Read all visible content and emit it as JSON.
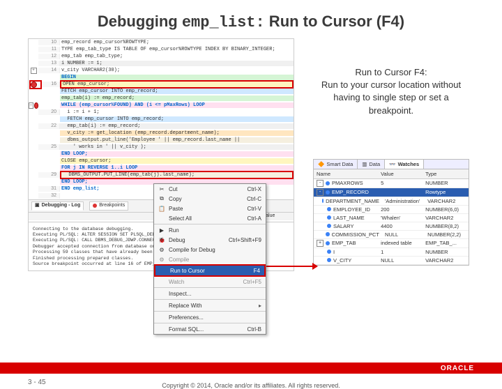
{
  "title": {
    "prefix": "Debugging ",
    "code": "emp_list:",
    "suffix": " Run to Cursor (F4)"
  },
  "explain": {
    "l1": "Run to Cursor F4:",
    "l2": "Run to your cursor location without having to single step or set a breakpoint."
  },
  "code_lines": [
    {
      "n": "10",
      "txt": "emp_record emp_cursor%ROWTYPE;"
    },
    {
      "n": "11",
      "txt": "TYPE emp_tab_type IS TABLE OF emp_cursor%ROWTYPE INDEX BY BINARY_INTEGER;"
    },
    {
      "n": "12",
      "txt": "emp_tab emp_tab_type;"
    },
    {
      "n": "13",
      "txt": "i NUMBER := 1;",
      "hl": "hl-gray"
    },
    {
      "n": "14",
      "txt": "v_city VARCHAR2(30);",
      "marker": "collapse-plus"
    },
    {
      "n": "",
      "txt": "BEGIN",
      "hl": "hl-green",
      "kw": true
    },
    {
      "n": "16",
      "txt": "OPEN emp_cursor;",
      "hl": "hl-yellow",
      "marker": "breakpoint-dot",
      "redbox": true,
      "redmarker": true
    },
    {
      "n": "",
      "txt": "FETCH emp_cursor INTO emp_record;",
      "hl": "hl-blue"
    },
    {
      "n": "",
      "txt": "emp_tab(i) := emp_record;",
      "hl": "hl-green"
    },
    {
      "n": "",
      "txt": "WHILE (emp_cursor%FOUND) AND (i <= pMaxRows) LOOP",
      "hl": "hl-pink",
      "kw": true,
      "marker": "collapse-minus",
      "extramark": "breakpoint-dot"
    },
    {
      "n": "20",
      "txt": "  i := i + 1;"
    },
    {
      "n": "",
      "txt": "  FETCH emp_cursor INTO emp_record;",
      "hl": "hl-blue"
    },
    {
      "n": "22",
      "txt": "  emp_tab(i) := emp_record;",
      "hl": "hl-gray"
    },
    {
      "n": "",
      "txt": "  v_city := get_location (emp_record.department_name);",
      "hl": "hl-orange"
    },
    {
      "n": "",
      "txt": "  dbms_output.put_line('Employee ' || emp_record.last_name ||",
      "hl": "hl-beige"
    },
    {
      "n": "25",
      "txt": "    ' works in ' || v_city );",
      "hl": "hl-gray"
    },
    {
      "n": "",
      "txt": "END LOOP;",
      "hl": "hl-pink",
      "kw": true
    },
    {
      "n": "",
      "txt": "CLOSE emp_cursor;",
      "hl": "hl-yellow"
    },
    {
      "n": "",
      "txt": "FOR j IN REVERSE 1..i LOOP",
      "hl": "hl-pink",
      "kw": true
    },
    {
      "n": "29",
      "txt": "  DBMS_OUTPUT.PUT_LINE(emp_tab(j).last_name);",
      "hl": "hl-beige",
      "redbox": true
    },
    {
      "n": "",
      "txt": "END LOOP;",
      "hl": "hl-pink",
      "kw": true
    },
    {
      "n": "31",
      "txt": "END emp_list;",
      "kw": true
    },
    {
      "n": "32",
      "txt": ""
    }
  ],
  "debug_tabs": {
    "log": "Debugging - Log",
    "bp": "Breakpoints"
  },
  "debug_header": {
    "name": "",
    "value": "Value"
  },
  "log_lines": [
    "Connecting to the database debugging.",
    "Executing PL/SQL: ALTER SESSION SET PLSQL_DEBUG=TRUE",
    "Executing PL/SQL: CALL DBMS_DEBUG_JDWP.CONNECT_TCP( ...",
    "Debugger accepted connection from database on port 19...",
    "Processing 59 classes that have already been prepared...",
    "Finished processing prepared classes.",
    "Source breakpoint occurred at line 16 of EMP_LIST.pls."
  ],
  "context_menu": [
    {
      "icon": "✂",
      "label": "Cut",
      "k": "Ctrl-X"
    },
    {
      "icon": "⧉",
      "label": "Copy",
      "k": "Ctrl-C"
    },
    {
      "icon": "📋",
      "label": "Paste",
      "k": "Ctrl-V"
    },
    {
      "icon": "",
      "label": "Select All",
      "k": "Ctrl-A"
    },
    {
      "sep": true
    },
    {
      "icon": "▶",
      "label": "Run",
      "k": ""
    },
    {
      "icon": "🐞",
      "label": "Debug",
      "k": "Ctrl+Shift+F9"
    },
    {
      "icon": "⚙",
      "label": "Compile for Debug",
      "k": ""
    },
    {
      "icon": "⚙",
      "label": "Compile",
      "k": "",
      "dim": true
    },
    {
      "icon": "",
      "label": "Run to Cursor",
      "k": "F4",
      "hl": true
    },
    {
      "icon": "",
      "label": "Watch",
      "k": "Ctrl+F5",
      "dim": true
    },
    {
      "sep": true
    },
    {
      "icon": "",
      "label": "Inspect...",
      "k": ""
    },
    {
      "sep": true
    },
    {
      "icon": "",
      "label": "Replace With",
      "k": "",
      "arrow": true
    },
    {
      "sep": true
    },
    {
      "icon": "",
      "label": "Preferences...",
      "k": ""
    },
    {
      "sep": true
    },
    {
      "icon": "",
      "label": "Format SQL...",
      "k": "Ctrl-B"
    }
  ],
  "watches": {
    "tabs": {
      "smart": "Smart Data",
      "data": "Data",
      "watches": "Watches"
    },
    "head": {
      "name": "Name",
      "value": "Value",
      "type": "Type"
    },
    "rows": [
      {
        "exp": "-",
        "name": "PMAXROWS",
        "val": "5",
        "type": "NUMBER"
      },
      {
        "exp": "-",
        "name": "EMP_RECORD",
        "val": "",
        "type": "Rowtype",
        "sel": true
      },
      {
        "exp": "",
        "name": "DEPARTMENT_NAME",
        "val": "'Administration'",
        "type": "VARCHAR2"
      },
      {
        "exp": "",
        "name": "EMPLOYEE_ID",
        "val": "200",
        "type": "NUMBER(6,0)"
      },
      {
        "exp": "",
        "name": "LAST_NAME",
        "val": "'Whalen'",
        "type": "VARCHAR2"
      },
      {
        "exp": "",
        "name": "SALARY",
        "val": "4400",
        "type": "NUMBER(8,2)"
      },
      {
        "exp": "",
        "name": "COMMISSION_PCT",
        "val": "NULL",
        "type": "NUMBER(2,2)"
      },
      {
        "exp": "+",
        "name": "EMP_TAB",
        "val": "indexed table",
        "type": "EMP_TAB_..."
      },
      {
        "exp": "",
        "name": "I",
        "val": "1",
        "type": "NUMBER"
      },
      {
        "exp": "",
        "name": "V_CITY",
        "val": "NULL",
        "type": "VARCHAR2"
      }
    ]
  },
  "footer": {
    "page": "3 - 45",
    "copyright": "Copyright © 2014, Oracle and/or its affiliates. All rights reserved.",
    "logo": "ORACLE"
  }
}
